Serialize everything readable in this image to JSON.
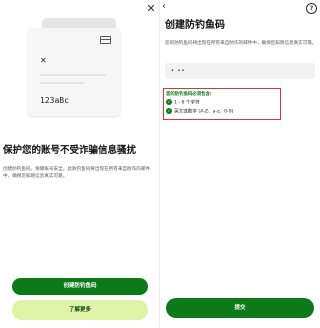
{
  "left_panel": {
    "close_icon_glyph": "✕",
    "illustration": {
      "card_icon": "card-icon",
      "x_icon_glyph": "✕",
      "code": "123aBc"
    },
    "title": "保护您的账号不受诈骗信息骚扰",
    "description": "创建防钓鱼码，保障账号安全。此防钓鱼码将出现在所有来自防诈的邮件中，确保您知晓信息真实可靠。",
    "primary_button": "创建防钓鱼码",
    "secondary_button": "了解更多"
  },
  "right_panel": {
    "back_icon_glyph": "‹",
    "help_icon_glyph": "?",
    "title": "创建防钓鱼码",
    "description": "您的防钓鱼码将出现在所有来自防诈的邮件中，确保您知晓信息真实可靠。",
    "input_value": "• ••",
    "requirements": {
      "title": "您的防钓鱼码必须包含:",
      "check_glyph": "✓",
      "items": [
        "1 - 6 个字符",
        "英文或数字 (A-Z、a-z、0-9)"
      ]
    },
    "submit_button": "提交"
  },
  "colors": {
    "primary_green": "#0d7a1a",
    "secondary_lime": "#dff2a8",
    "highlight_red": "#d93838"
  }
}
